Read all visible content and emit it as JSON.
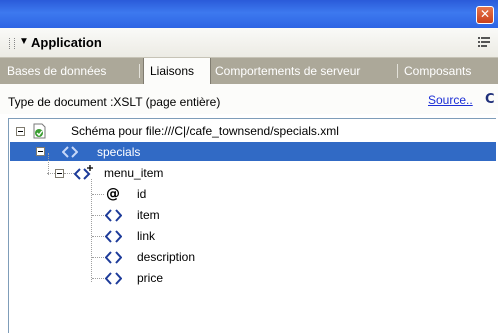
{
  "window": {
    "close_glyph": "✕"
  },
  "panel": {
    "collapse_glyph": "▼",
    "title": "Application"
  },
  "tabs": [
    {
      "label": "Bases de données",
      "active": false
    },
    {
      "label": "Liaisons",
      "active": true
    },
    {
      "label": "Comportements de serveur",
      "active": false
    },
    {
      "label": "Composants",
      "active": false
    }
  ],
  "info": {
    "doc_type": "Type de document :XSLT (page entière)",
    "source_link": "Source..",
    "refresh_glyph": "C"
  },
  "tree": {
    "schema_label": "Schéma pour file:///C|/cafe_townsend/specials.xml",
    "specials_label": "specials",
    "menu_item_label": "menu_item",
    "children": [
      {
        "label": "id",
        "icon": "attribute-icon",
        "glyph": "@"
      },
      {
        "label": "item",
        "icon": "element-icon"
      },
      {
        "label": "link",
        "icon": "element-icon"
      },
      {
        "label": "description",
        "icon": "element-icon"
      },
      {
        "label": "price",
        "icon": "element-icon"
      }
    ]
  },
  "colors": {
    "titlebar": "#2d64e4",
    "tab_bar": "#aca899",
    "selection": "#316ac5",
    "link": "#1d2fd6",
    "element_icon": "#1c3a99"
  }
}
